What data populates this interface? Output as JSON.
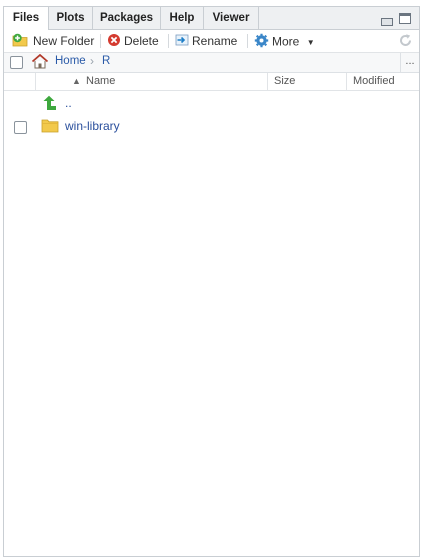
{
  "tabs": [
    {
      "label": "Files",
      "active": true
    },
    {
      "label": "Plots",
      "active": false
    },
    {
      "label": "Packages",
      "active": false
    },
    {
      "label": "Help",
      "active": false
    },
    {
      "label": "Viewer",
      "active": false
    }
  ],
  "toolbar": {
    "new_folder": "New Folder",
    "delete": "Delete",
    "rename": "Rename",
    "more": "More"
  },
  "breadcrumb": {
    "home": "Home",
    "current": "R",
    "overflow": "..."
  },
  "columns": {
    "name": "Name",
    "size": "Size",
    "modified": "Modified"
  },
  "files": [
    {
      "name": "..",
      "type": "parent-directory",
      "size": "",
      "modified": ""
    },
    {
      "name": "win-library",
      "type": "folder",
      "size": "",
      "modified": ""
    }
  ],
  "colors": {
    "accent_link": "#2a4f9c",
    "tab_strip_bg": "#eef0f2",
    "border": "#c9ced3",
    "up_arrow": "#3ea83e",
    "folder": "#f2c94c",
    "delete_icon": "#d43a2f",
    "more_gear": "#3a86c8"
  },
  "icons": {
    "new_folder": "folder-plus-icon",
    "delete": "delete-circle-icon",
    "rename": "rename-arrow-icon",
    "more": "gear-icon",
    "home": "home-icon",
    "refresh": "refresh-icon",
    "parent": "up-arrow-icon",
    "folder": "folder-icon"
  }
}
